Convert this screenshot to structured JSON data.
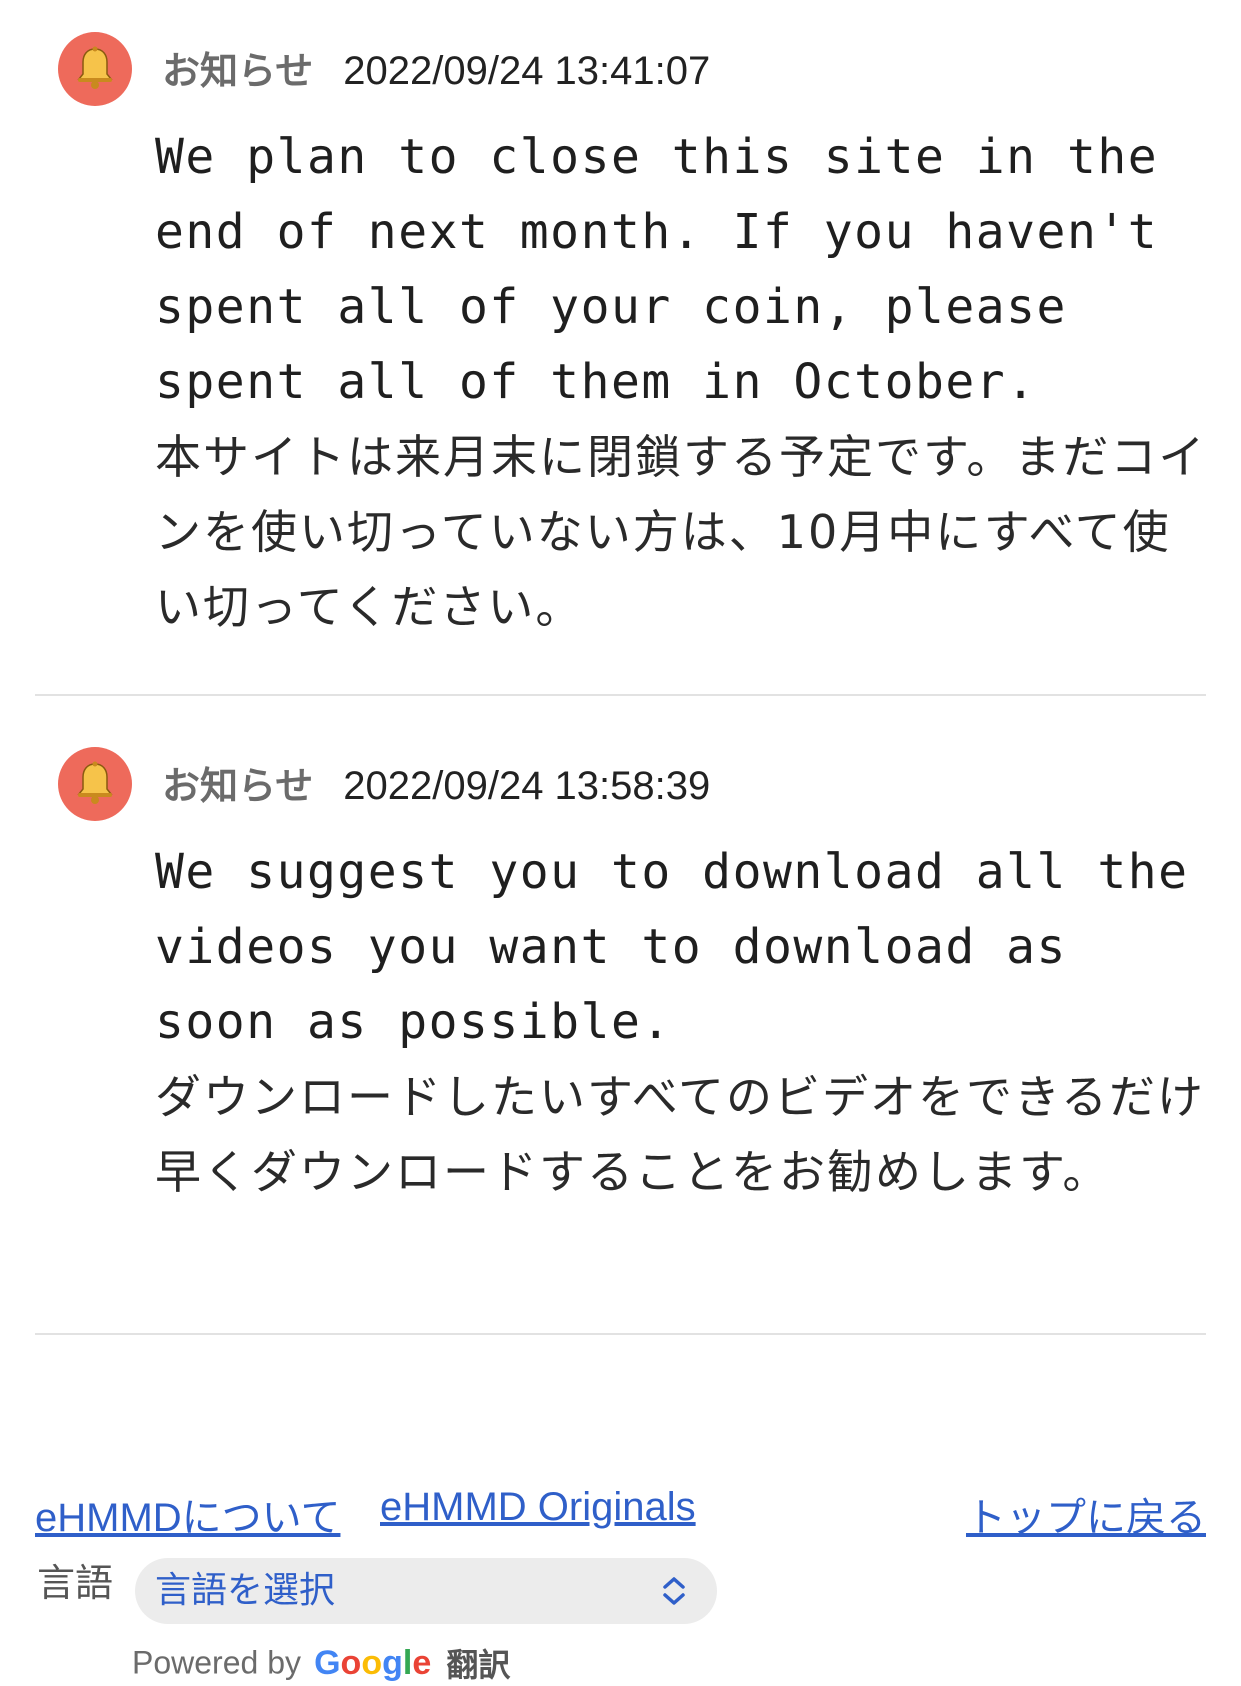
{
  "notices": [
    {
      "type": "お知らせ",
      "time": "2022/09/24 13:41:07",
      "message_en": "We plan to close this site in the end of next month. If you haven't spent all of your coin, please spent all of them in October.",
      "message_ja": "本サイトは来月末に閉鎖する予定です。まだコインを使い切っていない方は、10月中にすべて使い切ってください。"
    },
    {
      "type": "お知らせ",
      "time": "2022/09/24 13:58:39",
      "message_en": "We suggest you to download all the videos you want to download as soon as possible.",
      "message_ja": "ダウンロードしたいすべてのビデオをできるだけ早くダウンロードすることをお勧めします。"
    }
  ],
  "footer": {
    "about_link": "eHMMDについて",
    "originals_link": "eHMMD Originals",
    "top_link": "トップに戻る",
    "language_label": "言語",
    "language_select_value": "言語を選択",
    "powered_by": "Powered by",
    "google_letters": [
      "G",
      "o",
      "o",
      "g",
      "l",
      "e"
    ],
    "translate_label": "翻訳"
  },
  "icons": {
    "notice_avatar": "bell-icon",
    "select_arrow": "chevron-up-down-icon"
  },
  "colors": {
    "avatar_bg": "#ee6a5b",
    "bell": "#f6c34a",
    "link": "#2f5fc9",
    "divider": "#e2e2e2",
    "select_bg": "#ececec"
  }
}
